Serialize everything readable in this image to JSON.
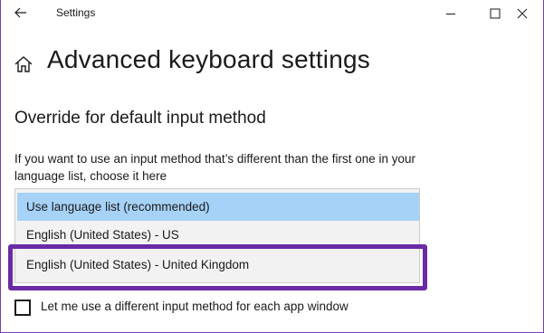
{
  "titlebar": {
    "app_title": "Settings",
    "back_icon": "arrow-left-icon",
    "minimize_icon": "minimize-icon",
    "maximize_icon": "maximize-icon",
    "close_icon": "close-icon"
  },
  "header": {
    "home_icon": "home-icon",
    "page_title": "Advanced keyboard settings"
  },
  "section": {
    "heading": "Override for default input method",
    "description": "If you want to use an input method that’s different than the first one in your language list, choose it here"
  },
  "dropdown": {
    "options": [
      {
        "label": "Use language list (recommended)",
        "selected": true
      },
      {
        "label": "English (United States) - US",
        "selected": false
      },
      {
        "label": "English (United States) - United Kingdom",
        "selected": false
      }
    ]
  },
  "checkbox": {
    "label": "Let me use a different input method for each app window",
    "checked": false
  },
  "colors": {
    "accent_selected": "#a6d2f7",
    "highlight_border": "#6a2aa6"
  }
}
